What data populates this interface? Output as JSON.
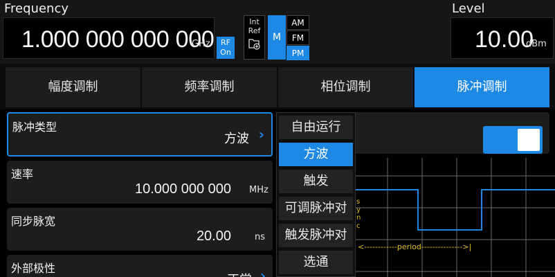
{
  "header": {
    "frequency_title": "Frequency",
    "frequency_value": "1.000 000 000 000",
    "frequency_unit": "GHz",
    "rf_line1": "RF",
    "rf_line2": "On",
    "ref_line1": "Int",
    "ref_line2": "Ref",
    "mod_label": "M",
    "modulations": [
      "AM",
      "FM",
      "PM"
    ],
    "level_title": "Level",
    "level_value": "10.00",
    "level_unit": "dBm"
  },
  "tabs": [
    "幅度调制",
    "频率调制",
    "相位调制",
    "脉冲调制"
  ],
  "active_tab": 3,
  "params": {
    "pulse_type": {
      "label": "脉冲类型",
      "value": "方波"
    },
    "rate": {
      "label": "速率",
      "value": "10.000 000 000",
      "unit": "MHz"
    },
    "sync_width": {
      "label": "同步脉宽",
      "value": "20.00",
      "unit": "ns"
    },
    "ext_polarity": {
      "label": "外部极性",
      "value": "正常"
    }
  },
  "dropdown": {
    "items": [
      "自由运行",
      "方波",
      "触发",
      "可调脉冲对",
      "触发脉冲对",
      "选通"
    ],
    "selected": 1
  },
  "toggle": {
    "state": "on"
  },
  "scope": {
    "sync_label": "sync",
    "period_label": "<------------period--------------->|"
  },
  "colors": {
    "accent": "#1e88e5",
    "background": "#000000",
    "panel": "#1d1d1d",
    "trace": "#1e88e5",
    "grid": "#7a7a7a",
    "annotation": "#e0c020"
  }
}
